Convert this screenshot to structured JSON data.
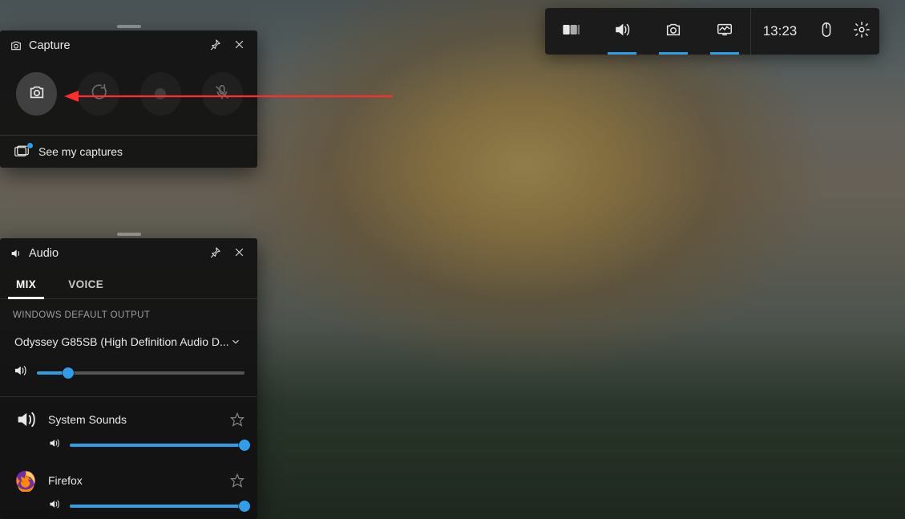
{
  "gamebar": {
    "clock": "13:23"
  },
  "capture": {
    "title": "Capture",
    "see_my": "See my captures"
  },
  "audio": {
    "title": "Audio",
    "tabs": {
      "mix": "MIX",
      "voice": "VOICE"
    },
    "section_default_output": "WINDOWS DEFAULT OUTPUT",
    "output_device": "Odyssey G85SB (High Definition Audio D...",
    "master_volume_pct": 15,
    "apps": [
      {
        "name": "System Sounds",
        "volume_pct": 100,
        "icon": "speaker",
        "color": "#ffffff"
      },
      {
        "name": "Firefox",
        "volume_pct": 100,
        "icon": "firefox",
        "color": "#ff8a00"
      }
    ]
  },
  "colors": {
    "accent": "#2f9ee6"
  }
}
